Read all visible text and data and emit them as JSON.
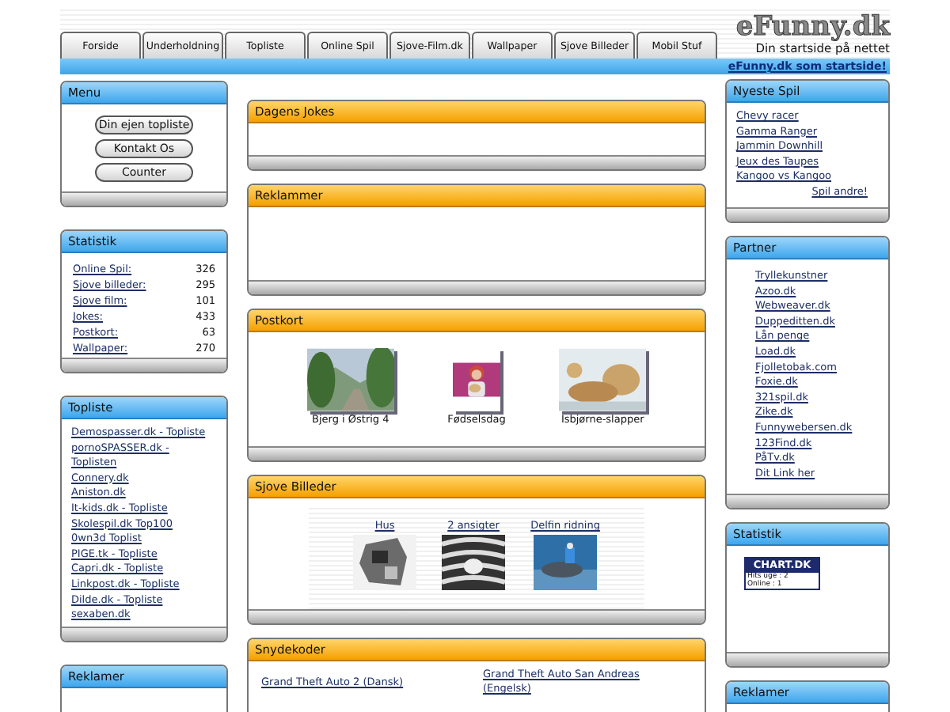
{
  "header": {
    "logo": "eFunny.dk",
    "tagline": "Din startside på nettet",
    "tabs": [
      "Forside",
      "Underholdning",
      "Topliste",
      "Online Spil",
      "Sjove-Film.dk",
      "Wallpaper",
      "Sjove Billeder",
      "Mobil Stuf"
    ],
    "startpage_link": "eFunny.dk som startside!"
  },
  "left": {
    "menu": {
      "title": "Menu",
      "buttons": [
        "Din ejen topliste",
        "Kontakt Os",
        "Counter"
      ]
    },
    "statistik": {
      "title": "Statistik",
      "rows": [
        {
          "label": "Online Spil:",
          "value": "326"
        },
        {
          "label": "Sjove billeder:",
          "value": "295"
        },
        {
          "label": "Sjove film:",
          "value": "101"
        },
        {
          "label": "Jokes:",
          "value": "433"
        },
        {
          "label": "Postkort:",
          "value": "63"
        },
        {
          "label": "Wallpaper:",
          "value": "270"
        }
      ]
    },
    "topliste": {
      "title": "Topliste",
      "links": [
        "Demospasser.dk - Topliste",
        "pornoSPASSER.dk - Toplisten",
        "Connery.dk",
        "Aniston.dk",
        "It-kids.dk - Topliste",
        "Skolespil.dk Top100",
        "0wn3d Toplist",
        "PIGE.tk - Topliste",
        "Capri.dk - Topliste",
        "Linkpost.dk - Topliste",
        "Dilde.dk - Topliste",
        "sexaben.dk"
      ]
    },
    "reklamer": {
      "title": "Reklamer"
    }
  },
  "center": {
    "jokes": {
      "title": "Dagens Jokes"
    },
    "reklammer": {
      "title": "Reklammer"
    },
    "postkort": {
      "title": "Postkort",
      "items": [
        {
          "caption": "Bjerg i Østrig 4"
        },
        {
          "caption": "Fødselsdag"
        },
        {
          "caption": "Isbjørne-slapper"
        }
      ]
    },
    "billeder": {
      "title": "Sjove Billeder",
      "items": [
        {
          "caption": "Hus"
        },
        {
          "caption": "2 ansigter"
        },
        {
          "caption": "Delfin ridning"
        }
      ]
    },
    "snydekoder": {
      "title": "Snydekoder",
      "links": [
        "Grand Theft Auto 2 (Dansk)",
        "Grand Theft Auto San Andreas (Engelsk)"
      ]
    }
  },
  "right": {
    "nyeste": {
      "title": "Nyeste Spil",
      "links": [
        "Chevy racer",
        "Gamma Ranger",
        "Jammin Downhill",
        "Jeux des Taupes",
        "Kangoo vs Kangoo"
      ],
      "more": "Spil andre!"
    },
    "partner": {
      "title": "Partner",
      "links": [
        "Tryllekunstner",
        "Azoo.dk",
        "Webweaver.dk",
        "Duppeditten.dk",
        "Lån penge",
        "Load.dk",
        "Fjolletobak.com",
        "Foxie.dk",
        "321spil.dk",
        "Zike.dk",
        "Funnywebersen.dk",
        "123Find.dk",
        "PåTv.dk",
        "Dit Link her"
      ]
    },
    "statistik": {
      "title": "Statistik",
      "badge_title": "CHART.DK",
      "badge_lines": [
        "Hits uge : 2",
        "Online : 1"
      ]
    },
    "reklamer": {
      "title": "Reklamer"
    }
  }
}
